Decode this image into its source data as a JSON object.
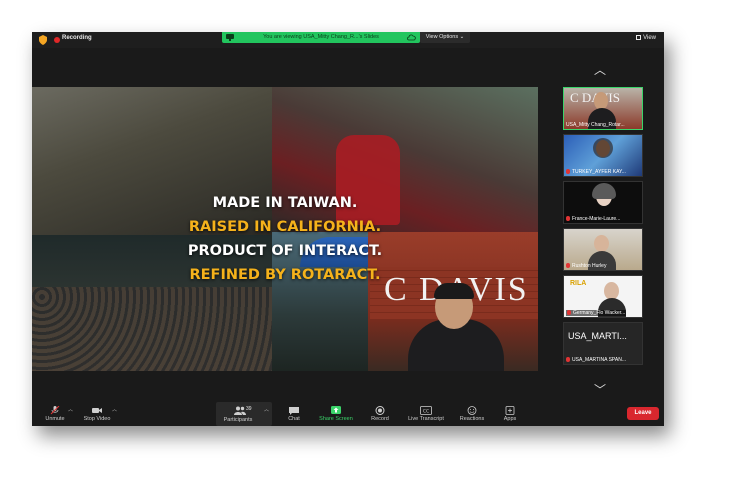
{
  "topbar": {
    "recording_label": "Recording",
    "viewing_banner": "You are viewing USA_Mitty Chang_R...'s Slides",
    "view_options_label": "View Options ⌄",
    "view_label": "View"
  },
  "slide": {
    "lines": [
      {
        "text": "MADE IN TAIWAN.",
        "color": "#ffffff"
      },
      {
        "text": "RAISED IN CALIFORNIA.",
        "color": "#f5b21b"
      },
      {
        "text": "PRODUCT OF INTERACT.",
        "color": "#ffffff"
      },
      {
        "text": "REFINED BY ROTARACT.",
        "color": "#f5b21b"
      }
    ],
    "sign_text": "C DAVIS"
  },
  "gallery": {
    "tiles": [
      {
        "name": "USA_Mitty Chang_Rotar...",
        "muted": false,
        "active": true,
        "sign": "C DAVIS"
      },
      {
        "name": "TURKEY_AYFER KAY...",
        "muted": true,
        "active": false
      },
      {
        "name": "France-Marie-Laure...",
        "muted": true,
        "active": false
      },
      {
        "name": "Rushton Hurley",
        "muted": true,
        "active": false
      },
      {
        "name": "Germany_Flo Wacker...",
        "muted": true,
        "active": false,
        "logo": "RILA"
      },
      {
        "name": "USA_MARTINA SPAN...",
        "muted": true,
        "active": false,
        "display_name": "USA_MARTI..."
      }
    ]
  },
  "toolbar": {
    "unmute": "Unmute",
    "stop_video": "Stop Video",
    "participants": "Participants",
    "participant_count": "39",
    "chat": "Chat",
    "share_screen": "Share Screen",
    "record": "Record",
    "live_transcript": "Live Transcript",
    "reactions": "Reactions",
    "apps": "Apps",
    "leave": "Leave"
  },
  "colors": {
    "accent_green": "#22c55e",
    "leave_red": "#d9272e",
    "slide_yellow": "#f5b21b"
  }
}
